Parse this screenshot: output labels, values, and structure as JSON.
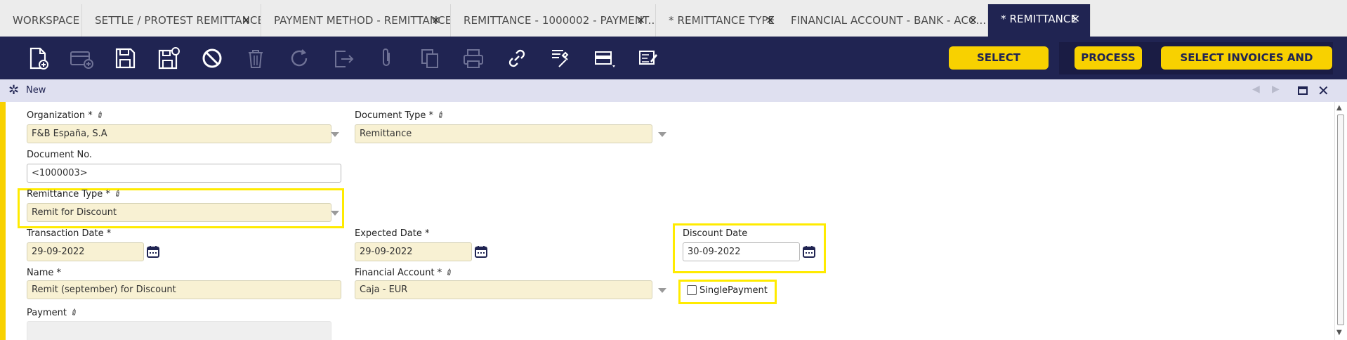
{
  "tabs": [
    {
      "label": "WORKSPACE",
      "closable": false
    },
    {
      "label": "SETTLE / PROTEST REMITTANCES",
      "closable": true
    },
    {
      "label": "PAYMENT METHOD - REMITTANCE",
      "closable": true
    },
    {
      "label": "REMITTANCE - 1000002 - PAYMENT...",
      "closable": true
    },
    {
      "label": "* REMITTANCE TYPE",
      "closable": true
    },
    {
      "label": "FINANCIAL ACCOUNT - BANK - ACC...",
      "closable": true
    },
    {
      "label": "* REMITTANCE",
      "closable": true,
      "active": true
    }
  ],
  "toolbar": {
    "icons": [
      "new-document-icon",
      "new-row-icon",
      "save-icon",
      "save-and-close-icon",
      "undo-icon",
      "delete-icon",
      "refresh-icon",
      "export-icon",
      "attachment-icon",
      "clone-icon",
      "print-icon",
      "link-icon",
      "audit-tools-icon",
      "form-view-icon",
      "notes-icon"
    ],
    "buttons": {
      "select_payments": "SELECT PAYMENTS",
      "process": "PROCESS",
      "select_invoices": "SELECT INVOICES AND ORDERS"
    },
    "accent": "#f8d100",
    "background": "#202452"
  },
  "form_header": {
    "title": "New"
  },
  "fields": {
    "organization": {
      "label": "Organization *",
      "value": "F&B España, S.A"
    },
    "document_type": {
      "label": "Document Type *",
      "value": "Remittance"
    },
    "document_no": {
      "label": "Document No.",
      "value": "<1000003>"
    },
    "remittance_type": {
      "label": "Remittance Type *",
      "value": "Remit for Discount"
    },
    "transaction_date": {
      "label": "Transaction Date *",
      "value": "29-09-2022"
    },
    "expected_date": {
      "label": "Expected Date *",
      "value": "29-09-2022"
    },
    "discount_date": {
      "label": "Discount Date",
      "value": "30-09-2022"
    },
    "name": {
      "label": "Name *",
      "value": "Remit (september)  for Discount"
    },
    "financial_account": {
      "label": "Financial Account *",
      "value": "Caja - EUR"
    },
    "single_payment": {
      "label": "SinglePayment",
      "checked": false
    },
    "payment": {
      "label": "Payment",
      "value": ""
    }
  },
  "colors": {
    "highlight": "#ffeb00",
    "field_background": "#f8f1d3"
  }
}
